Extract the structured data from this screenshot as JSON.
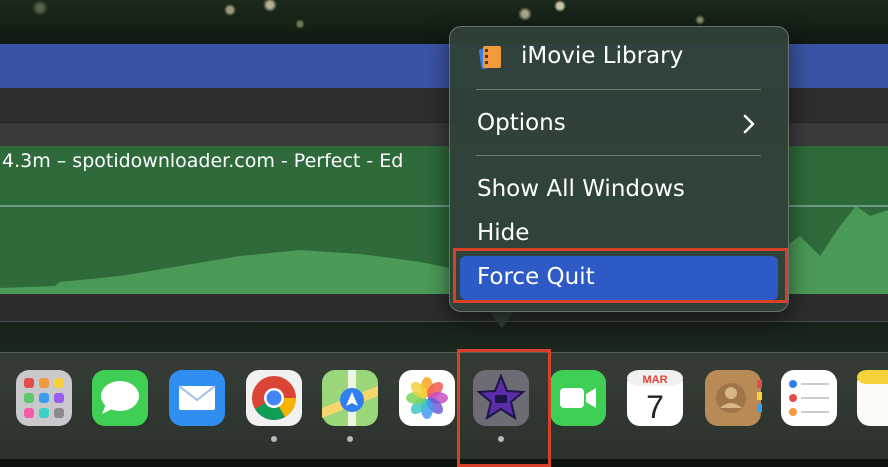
{
  "clip": {
    "title": "4.3m – spotidownloader.com - Perfect - Ed"
  },
  "context_menu": {
    "library_label": "iMovie Library",
    "options_label": "Options",
    "show_all_windows_label": "Show All Windows",
    "hide_label": "Hide",
    "force_quit_label": "Force Quit",
    "highlight_color": "#2e5ac5",
    "annotation_color": "#d7412a"
  },
  "dock": {
    "apps": [
      {
        "name": "Launchpad",
        "icon": "launchpad-icon",
        "running": false
      },
      {
        "name": "Messages",
        "icon": "messages-icon",
        "running": true
      },
      {
        "name": "Mail",
        "icon": "mail-icon",
        "running": false
      },
      {
        "name": "Chrome",
        "icon": "chrome-icon",
        "running": true
      },
      {
        "name": "Maps",
        "icon": "maps-icon",
        "running": true
      },
      {
        "name": "Photos",
        "icon": "photos-icon",
        "running": false
      },
      {
        "name": "iMovie",
        "icon": "imovie-icon",
        "running": true
      },
      {
        "name": "FaceTime",
        "icon": "facetime-icon",
        "running": false
      },
      {
        "name": "Calendar",
        "icon": "calendar-icon",
        "running": false
      },
      {
        "name": "Contacts",
        "icon": "contacts-icon",
        "running": false
      },
      {
        "name": "Reminders",
        "icon": "reminders-icon",
        "running": false
      },
      {
        "name": "Notes",
        "icon": "notes-icon",
        "running": false
      }
    ],
    "calendar_month": "MAR",
    "calendar_day": "7"
  }
}
